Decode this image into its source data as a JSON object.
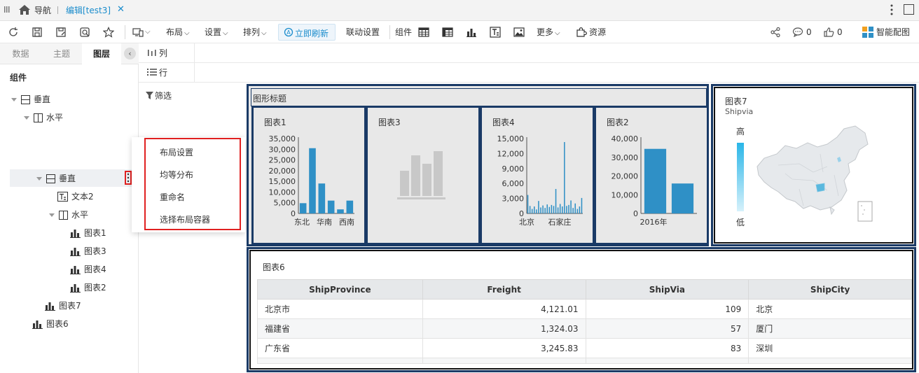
{
  "tabbar": {
    "nav_label": "导航",
    "tab_label": "编辑[test3]"
  },
  "toolbar": {
    "layout": "布局",
    "settings": "设置",
    "arrange": "排列",
    "refresh": "立即刷新",
    "linkage": "联动设置",
    "component": "组件",
    "more": "更多",
    "resource": "资源",
    "share_count": "0",
    "like_count": "0",
    "smart": "智能配图"
  },
  "left_panel": {
    "tabs": [
      "数据",
      "主题",
      "图层"
    ],
    "section_title": "组件",
    "tree": [
      "垂直",
      "水平",
      "垂直",
      "文本2",
      "水平",
      "图表1",
      "图表3",
      "图表4",
      "图表2",
      "图表7",
      "图表6"
    ]
  },
  "shelf": {
    "columns": "列",
    "rows": "行",
    "filter": "筛选"
  },
  "context_menu": {
    "items": [
      "布局设置",
      "均等分布",
      "重命名",
      "选择布局容器"
    ]
  },
  "canvas": {
    "container_title": "图形标题",
    "chart1": {
      "title": "图表1"
    },
    "chart3": {
      "title": "图表3"
    },
    "chart4": {
      "title": "图表4"
    },
    "chart2": {
      "title": "图表2"
    },
    "chart7": {
      "title": "图表7",
      "legend_title": "Shipvia",
      "legend_high": "高",
      "legend_low": "低"
    },
    "chart6": {
      "title": "图表6",
      "columns": [
        "ShipProvince",
        "Freight",
        "ShipVia",
        "ShipCity"
      ],
      "rows": [
        [
          "北京市",
          "4,121.01",
          "109",
          "北京"
        ],
        [
          "福建省",
          "1,324.03",
          "57",
          "厦门"
        ],
        [
          "广东省",
          "3,245.83",
          "83",
          "深圳"
        ]
      ]
    }
  },
  "colors": {
    "accent": "#2f90c6",
    "frame": "#1a3a66",
    "highlight": "#e02020",
    "link": "#1a8ccc"
  },
  "chart_data": [
    {
      "type": "bar",
      "title": "图表1",
      "ylim": [
        0,
        35000
      ],
      "ytick_labels": [
        "35,000",
        "30,000",
        "25,000",
        "20,000",
        "15,000",
        "10,000",
        "5,000",
        "0"
      ],
      "categories": [
        "东北",
        "",
        "华南",
        "",
        "西南",
        ""
      ],
      "x_tick_labels": [
        "东北",
        "华南",
        "西南"
      ],
      "values": [
        4800,
        30500,
        14000,
        6000,
        1900,
        6000
      ]
    },
    {
      "type": "bar",
      "title": "图表4",
      "ylim": [
        0,
        15000
      ],
      "ytick_labels": [
        "15,000",
        "12,000",
        "9,000",
        "6,000",
        "3,000",
        "0"
      ],
      "x_tick_labels": [
        "北京",
        "石家庄"
      ],
      "values": [
        3700,
        1500,
        900,
        1400,
        800,
        2500,
        1200,
        1600,
        1100,
        1800,
        1300,
        1700,
        1500,
        4900,
        1200,
        1900,
        1400,
        14300,
        1500,
        1700,
        2600,
        1100,
        2000,
        900,
        1400,
        3100
      ]
    },
    {
      "type": "bar",
      "title": "图表2",
      "ylim": [
        0,
        40000
      ],
      "ytick_labels": [
        "40,000",
        "30,000",
        "20,000",
        "10,000",
        "0"
      ],
      "x_tick_labels": [
        "2016年"
      ],
      "values": [
        34500,
        16000
      ]
    }
  ]
}
